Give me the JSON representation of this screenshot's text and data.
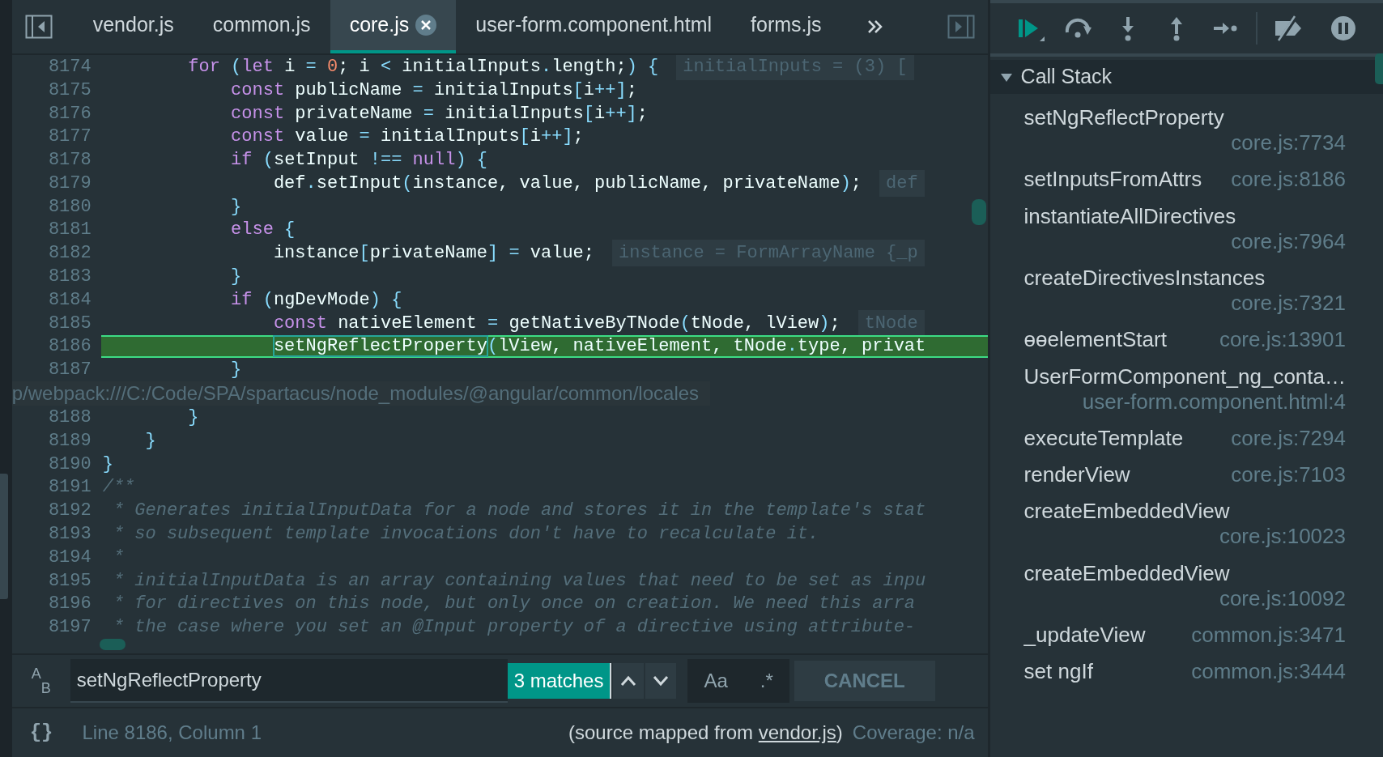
{
  "tabs": [
    {
      "label": "vendor.js",
      "selected": false,
      "closable": false
    },
    {
      "label": "common.js",
      "selected": false,
      "closable": false
    },
    {
      "label": "core.js",
      "selected": true,
      "closable": true
    },
    {
      "label": "user-form.component.html",
      "selected": false,
      "closable": false
    },
    {
      "label": "forms.js",
      "selected": false,
      "closable": false
    }
  ],
  "code_lines": [
    {
      "number": "8174",
      "current": false,
      "tokens": [
        {
          "kind": "kw",
          "text": "        for"
        },
        {
          "kind": "p",
          "text": " ("
        },
        {
          "kind": "kw",
          "text": "let"
        },
        {
          "kind": "id",
          "text": " i "
        },
        {
          "kind": "p",
          "text": "="
        },
        {
          "kind": "num",
          "text": " 0"
        },
        {
          "kind": "id",
          "text": "; i "
        },
        {
          "kind": "p",
          "text": "<"
        },
        {
          "kind": "id",
          "text": " initialInputs"
        },
        {
          "kind": "p",
          "text": "."
        },
        {
          "kind": "id",
          "text": "length;"
        },
        {
          "kind": "p",
          "text": ") {"
        }
      ],
      "hint": "initialInputs = (3) ["
    },
    {
      "number": "8175",
      "current": false,
      "tokens": [
        {
          "kind": "kw",
          "text": "            const"
        },
        {
          "kind": "id",
          "text": " publicName "
        },
        {
          "kind": "p",
          "text": "="
        },
        {
          "kind": "id",
          "text": " initialInputs"
        },
        {
          "kind": "p",
          "text": "["
        },
        {
          "kind": "id",
          "text": "i"
        },
        {
          "kind": "p",
          "text": "++]"
        },
        {
          "kind": "id",
          "text": ";"
        }
      ]
    },
    {
      "number": "8176",
      "current": false,
      "tokens": [
        {
          "kind": "kw",
          "text": "            const"
        },
        {
          "kind": "id",
          "text": " privateName "
        },
        {
          "kind": "p",
          "text": "="
        },
        {
          "kind": "id",
          "text": " initialInputs"
        },
        {
          "kind": "p",
          "text": "["
        },
        {
          "kind": "id",
          "text": "i"
        },
        {
          "kind": "p",
          "text": "++]"
        },
        {
          "kind": "id",
          "text": ";"
        }
      ]
    },
    {
      "number": "8177",
      "current": false,
      "tokens": [
        {
          "kind": "kw",
          "text": "            const"
        },
        {
          "kind": "id",
          "text": " value "
        },
        {
          "kind": "p",
          "text": "="
        },
        {
          "kind": "id",
          "text": " initialInputs"
        },
        {
          "kind": "p",
          "text": "["
        },
        {
          "kind": "id",
          "text": "i"
        },
        {
          "kind": "p",
          "text": "++]"
        },
        {
          "kind": "id",
          "text": ";"
        }
      ]
    },
    {
      "number": "8178",
      "current": false,
      "tokens": [
        {
          "kind": "kw",
          "text": "            if"
        },
        {
          "kind": "p",
          "text": " ("
        },
        {
          "kind": "id",
          "text": "setInput "
        },
        {
          "kind": "p",
          "text": "!=="
        },
        {
          "kind": "kw",
          "text": " null"
        },
        {
          "kind": "p",
          "text": ") {"
        }
      ]
    },
    {
      "number": "8179",
      "current": false,
      "tokens": [
        {
          "kind": "id",
          "text": "                def"
        },
        {
          "kind": "p",
          "text": "."
        },
        {
          "kind": "id",
          "text": "setInput"
        },
        {
          "kind": "p",
          "text": "("
        },
        {
          "kind": "id",
          "text": "instance, value, publicName, privateName"
        },
        {
          "kind": "p",
          "text": ")"
        },
        {
          "kind": "id",
          "text": ";"
        }
      ],
      "hint": "def"
    },
    {
      "number": "8180",
      "current": false,
      "tokens": [
        {
          "kind": "p",
          "text": "            }"
        }
      ]
    },
    {
      "number": "8181",
      "current": false,
      "tokens": [
        {
          "kind": "kw",
          "text": "            else"
        },
        {
          "kind": "p",
          "text": " {"
        }
      ]
    },
    {
      "number": "8182",
      "current": false,
      "tokens": [
        {
          "kind": "id",
          "text": "                instance"
        },
        {
          "kind": "p",
          "text": "["
        },
        {
          "kind": "id",
          "text": "privateName"
        },
        {
          "kind": "p",
          "text": "] ="
        },
        {
          "kind": "id",
          "text": " value;"
        }
      ],
      "hint": "instance = FormArrayName {_p"
    },
    {
      "number": "8183",
      "current": false,
      "tokens": [
        {
          "kind": "p",
          "text": "            }"
        }
      ]
    },
    {
      "number": "8184",
      "current": false,
      "tokens": [
        {
          "kind": "kw",
          "text": "            if"
        },
        {
          "kind": "p",
          "text": " ("
        },
        {
          "kind": "id",
          "text": "ngDevMode"
        },
        {
          "kind": "p",
          "text": ") {"
        }
      ]
    },
    {
      "number": "8185",
      "current": false,
      "tokens": [
        {
          "kind": "kw",
          "text": "                const"
        },
        {
          "kind": "id",
          "text": " nativeElement "
        },
        {
          "kind": "p",
          "text": "="
        },
        {
          "kind": "id",
          "text": " getNativeByTNode"
        },
        {
          "kind": "p",
          "text": "("
        },
        {
          "kind": "id",
          "text": "tNode, lView"
        },
        {
          "kind": "p",
          "text": ")"
        },
        {
          "kind": "id",
          "text": ";"
        }
      ],
      "hint": "tNode"
    },
    {
      "number": "8186",
      "current": true,
      "tokens": [
        {
          "kind": "match",
          "text": "                setNgReflectProperty"
        },
        {
          "kind": "p",
          "text": "("
        },
        {
          "kind": "id",
          "text": "lView, nativeElement, tNode"
        },
        {
          "kind": "p",
          "text": "."
        },
        {
          "kind": "id",
          "text": "type, privat"
        }
      ]
    },
    {
      "number": "8187",
      "current": false,
      "tokens": [
        {
          "kind": "p",
          "text": "            }"
        }
      ]
    },
    {
      "number": "8188",
      "current": false,
      "tokens": [
        {
          "kind": "p",
          "text": "        }"
        }
      ]
    },
    {
      "number": "8189",
      "current": false,
      "tokens": [
        {
          "kind": "p",
          "text": "    }"
        }
      ]
    },
    {
      "number": "8190",
      "current": false,
      "tokens": [
        {
          "kind": "p",
          "text": "}"
        }
      ]
    },
    {
      "number": "8191",
      "current": false,
      "tokens": [
        {
          "kind": "cm",
          "text": "/**"
        }
      ]
    },
    {
      "number": "8192",
      "current": false,
      "tokens": [
        {
          "kind": "cm",
          "text": " * Generates initialInputData for a node and stores it in the template's stat"
        }
      ]
    },
    {
      "number": "8193",
      "current": false,
      "tokens": [
        {
          "kind": "cm",
          "text": " * so subsequent template invocations don't have to recalculate it."
        }
      ]
    },
    {
      "number": "8194",
      "current": false,
      "tokens": [
        {
          "kind": "cm",
          "text": " *"
        }
      ]
    },
    {
      "number": "8195",
      "current": false,
      "tokens": [
        {
          "kind": "cm",
          "text": " * initialInputData is an array containing values that need to be set as inpu"
        }
      ]
    },
    {
      "number": "8196",
      "current": false,
      "tokens": [
        {
          "kind": "cm",
          "text": " * for directives on this node, but only once on creation. We need this arra"
        }
      ]
    },
    {
      "number": "8197",
      "current": false,
      "tokens": [
        {
          "kind": "cm",
          "text": " * the case where you set an @Input property of a directive using attribute-"
        }
      ]
    }
  ],
  "tooltip": "p/webpack:///C:/Code/SPA/spartacus/node_modules/@angular/common/locales",
  "search": {
    "replace_toggle": {
      "top": "A",
      "bottom": "B"
    },
    "value": "setNgReflectProperty",
    "matches": "3 matches",
    "case_button": "Aa",
    "regex_button": ".*",
    "cancel": "CANCEL"
  },
  "status_bar": {
    "format_button": "{}",
    "position": "Line 8186, Column 1",
    "source_prefix": "(source mapped from ",
    "source_link": "vendor.js",
    "source_suffix": ")",
    "coverage": "Coverage: n/a"
  },
  "call_stack": {
    "title": "Call Stack",
    "expanded": true,
    "frames": [
      {
        "name": "setNgReflectProperty",
        "location": "core.js:7734"
      },
      {
        "name": "setInputsFromAttrs",
        "location": "core.js:8186"
      },
      {
        "name": "instantiateAllDirectives",
        "location": "core.js:7964"
      },
      {
        "name": "createDirectivesInstances",
        "location": "core.js:7321"
      },
      {
        "name": "ɵɵelementStart",
        "location": "core.js:13901"
      },
      {
        "name": "UserFormComponent_ng_conta…",
        "location": "user-form.component.html:4"
      },
      {
        "name": "executeTemplate",
        "location": "core.js:7294"
      },
      {
        "name": "renderView",
        "location": "core.js:7103"
      },
      {
        "name": "createEmbeddedView",
        "location": "core.js:10023"
      },
      {
        "name": "createEmbeddedView",
        "location": "core.js:10092"
      },
      {
        "name": "_updateView",
        "location": "common.js:3471"
      },
      {
        "name": "set ngIf",
        "location": "common.js:3444"
      }
    ]
  }
}
